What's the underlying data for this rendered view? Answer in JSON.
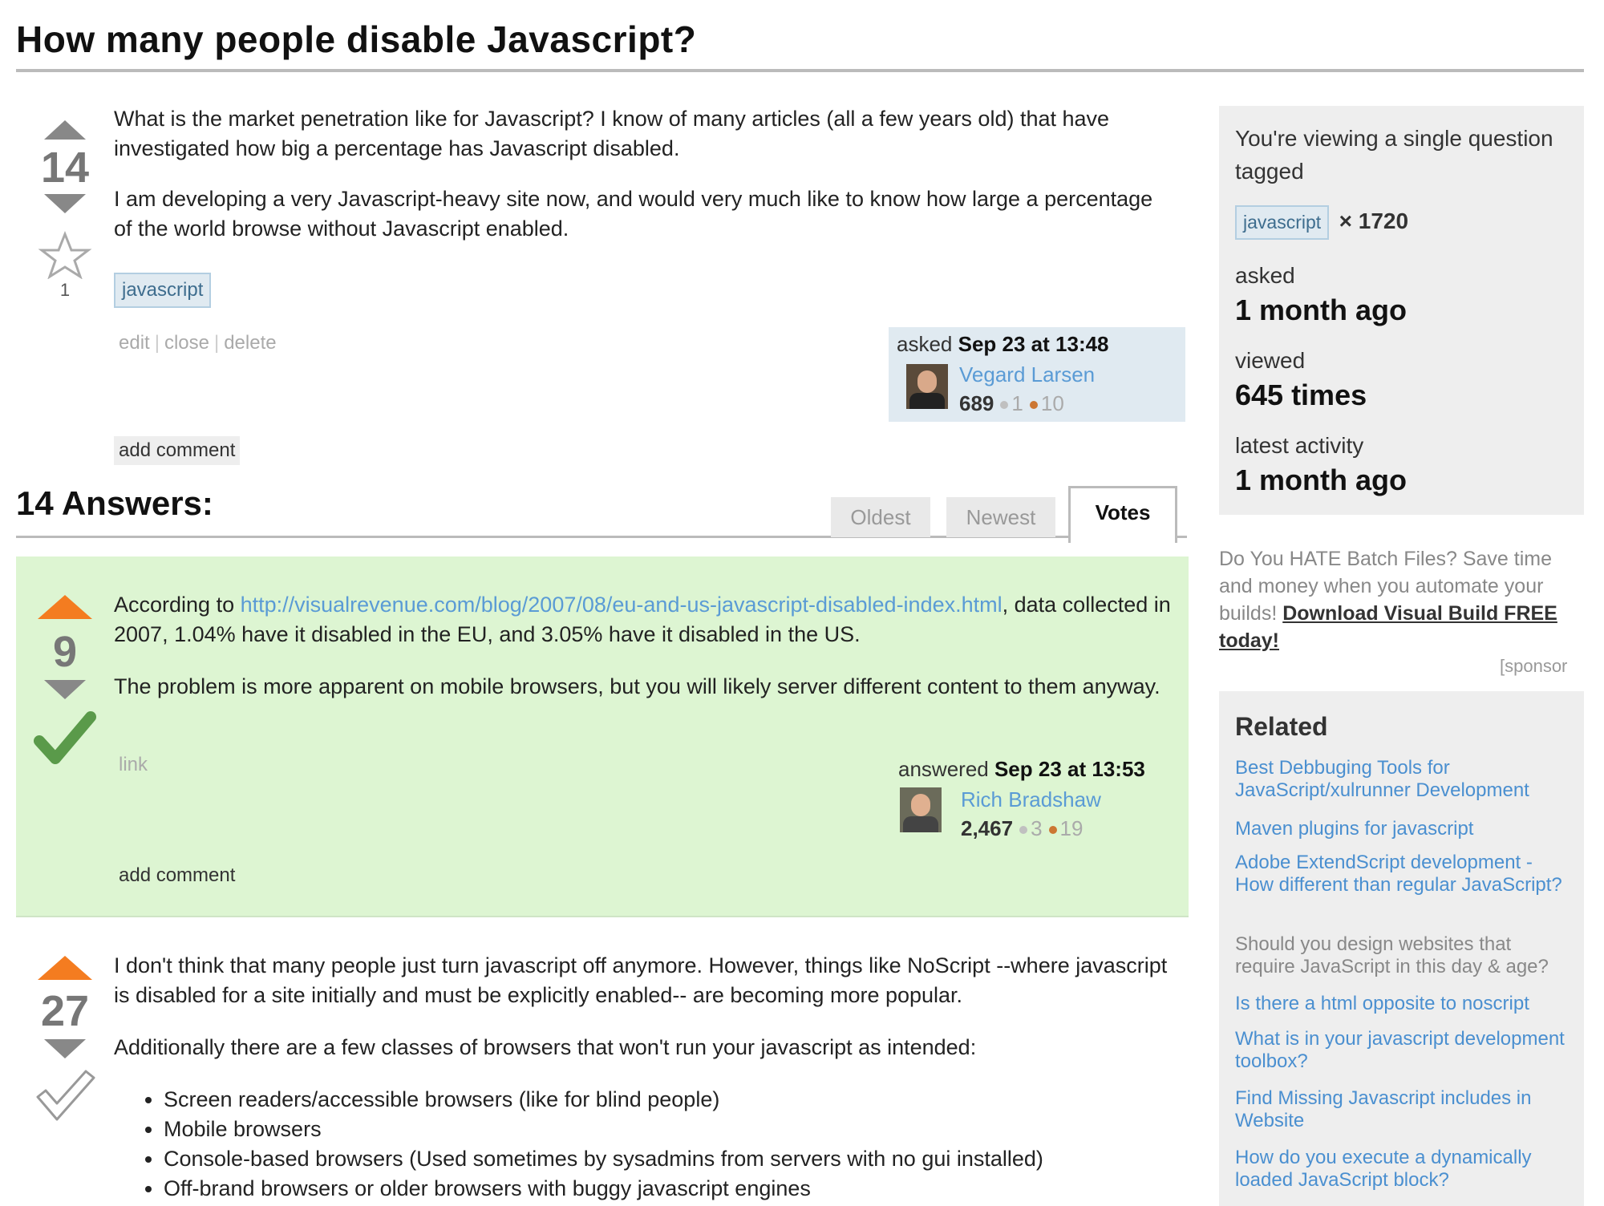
{
  "question": {
    "title": "How many people disable Javascript?",
    "votes": "14",
    "favorites": "1",
    "paragraphs": [
      "What is the market penetration like for Javascript? I know of many articles (all a few years old) that have investigated how big a percentage has Javascript disabled.",
      "I am developing a very Javascript-heavy site now, and would very much like to know how large a percentage of the world browse without Javascript enabled."
    ],
    "tag": "javascript",
    "menu": {
      "edit": "edit",
      "close": "close",
      "delete": "delete",
      "sep": "|"
    },
    "add_comment": "add comment",
    "asked_label": "asked",
    "asked_date": "Sep 23 at 13:48",
    "user": {
      "name": "Vegard Larsen",
      "rep": "689",
      "silver": "1",
      "bronze": "10"
    }
  },
  "answers_header": {
    "title": "14 Answers:",
    "tabs": [
      "Oldest",
      "Newest",
      "Votes"
    ],
    "active_tab": "Votes"
  },
  "answer1": {
    "votes": "9",
    "text_before_link": "According to ",
    "link": "http://visualrevenue.com/blog/2007/08/eu-and-us-javascript-disabled-index.html",
    "text_after_link": ", data collected in 2007, 1.04% have it disabled in the EU, and 3.05% have it disabled in the US.",
    "paragraph2": "The problem is more apparent on mobile browsers, but you will likely server different content to them anyway.",
    "link_label": "link",
    "answered_label": "answered",
    "answered_date": "Sep 23 at 13:53",
    "user": {
      "name": "Rich Bradshaw",
      "rep": "2,467",
      "silver": "3",
      "bronze": "19"
    },
    "add_comment": "add comment"
  },
  "answer2": {
    "votes": "27",
    "paragraph1": "I don't think that many people just turn javascript off anymore. However, things like NoScript --where javascript is disabled for a site initially and must be explicitly enabled-- are becoming more popular.",
    "paragraph2": "Additionally there are a few classes of browsers that won't run your javascript as intended:",
    "bullets": [
      "Screen readers/accessible browsers (like for blind people)",
      "Mobile browsers",
      "Console-based browsers (Used sometimes by sysadmins from servers with no gui installed)",
      "Off-brand browsers or older browsers with buggy javascript engines"
    ]
  },
  "sidebar": {
    "viewing_text": "You're viewing a single question tagged",
    "tag": "javascript",
    "tag_count": "× 1720",
    "asked_label": "asked",
    "asked_value": "1 month ago",
    "viewed_label": "viewed",
    "viewed_value": "645 times",
    "activity_label": "latest activity",
    "activity_value": "1 month ago",
    "sponsor_text": "Do You HATE Batch Files? Save time and money when you automate your builds! ",
    "sponsor_link": "Download Visual Build FREE today!",
    "sponsor_tag": "[sponsor",
    "related_title": "Related",
    "related": [
      "Best Debbuging Tools for JavaScript/xulrunner Development",
      "Maven plugins for javascript",
      "Adobe ExtendScript development - How different than regular JavaScript?",
      "Should you design websites that require JavaScript in this day & age?",
      "Is there a html opposite to noscript",
      "What is in your javascript development toolbox?",
      "Find Missing Javascript includes in Website",
      "How do you execute a dynamically loaded JavaScript block?"
    ]
  },
  "colors": {
    "accent_link": "#5a9bd5",
    "upvote_orange": "#f47c20",
    "accepted_bg": "#ddf5d2",
    "accepted_check": "#5a9a4a"
  }
}
